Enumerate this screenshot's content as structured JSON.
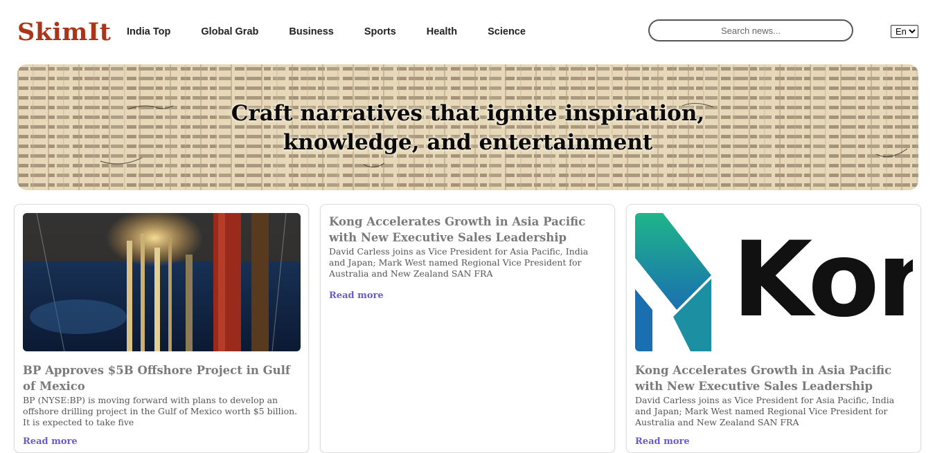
{
  "header": {
    "logo": "SkimIt",
    "nav": [
      "India Top",
      "Global Grab",
      "Business",
      "Sports",
      "Health",
      "Science"
    ],
    "search_placeholder": "Search news...",
    "language": "En"
  },
  "hero": {
    "line1": "Craft narratives that ignite inspiration,",
    "line2": "knowledge, and entertainment"
  },
  "cards": [
    {
      "title": "BP Approves $5B Offshore Project in Gulf of Mexico",
      "description": "BP (NYSE:BP) is moving forward with plans to develop an offshore drilling project in the Gulf of Mexico worth $5 billion. It is expected to take five",
      "read_more": "Read more",
      "image": "offshore-rig-image"
    },
    {
      "title": "Kong Accelerates Growth in Asia Pacific with New Executive Sales Leadership",
      "description": "David Carless joins as Vice President for Asia Pacific, India and Japan; Mark West named Regional Vice President for Australia and New Zealand SAN FRA",
      "read_more": "Read more"
    },
    {
      "title": "Kong Accelerates Growth in Asia Pacific with New Executive Sales Leadership",
      "description": "David Carless joins as Vice President for Asia Pacific, India and Japan; Mark West named Regional Vice President for Australia and New Zealand SAN FRA",
      "read_more": "Read more",
      "image": "kong-logo-image",
      "image_text": "Kon"
    }
  ],
  "colors": {
    "brand": "#a9361a",
    "link": "#6a5acd",
    "title": "#7a7a7a"
  }
}
